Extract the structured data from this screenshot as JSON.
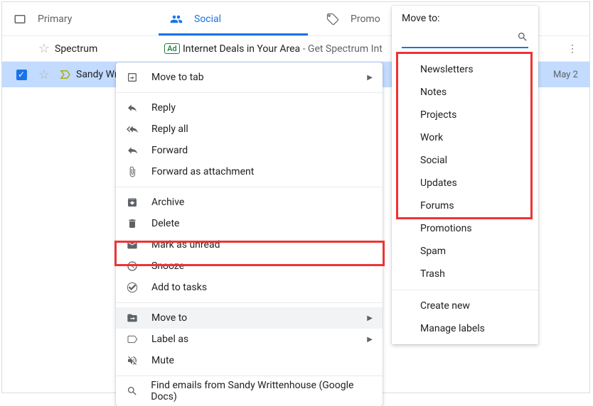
{
  "tabs": {
    "primary": "Primary",
    "social": "Social",
    "promotions": "Promo"
  },
  "ad": {
    "sender": "Spectrum",
    "badge": "Ad",
    "subject": "Internet Deals in Your Area",
    "preview": " - Get Spectrum Int"
  },
  "email": {
    "sender": "Sandy Wr",
    "date": "May 2"
  },
  "context_menu": {
    "move_to_tab": "Move to tab",
    "reply": "Reply",
    "reply_all": "Reply all",
    "forward": "Forward",
    "forward_attachment": "Forward as attachment",
    "archive": "Archive",
    "delete": "Delete",
    "mark_unread": "Mark as unread",
    "snooze": "Snooze",
    "add_tasks": "Add to tasks",
    "move_to": "Move to",
    "label_as": "Label as",
    "mute": "Mute",
    "find_emails": "Find emails from Sandy Writtenhouse (Google Docs)"
  },
  "moveto": {
    "title": "Move to:",
    "labels": [
      "Newsletters",
      "Notes",
      "Projects",
      "Work",
      "Social",
      "Updates",
      "Forums",
      "Promotions"
    ],
    "spam": "Spam",
    "trash": "Trash",
    "create": "Create new",
    "manage": "Manage labels"
  }
}
